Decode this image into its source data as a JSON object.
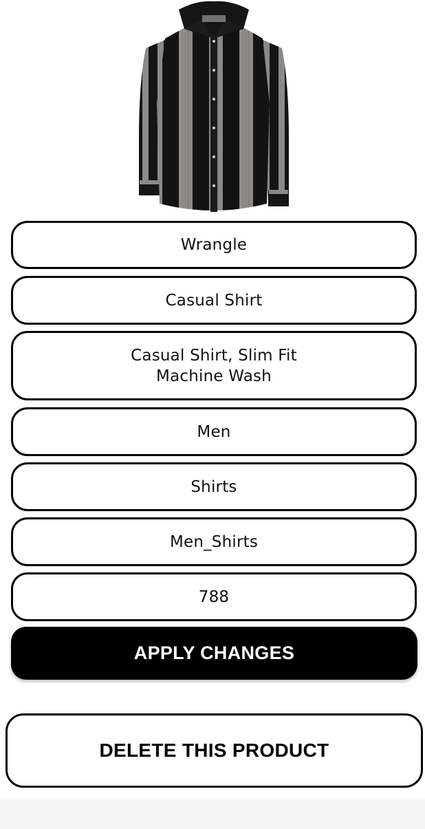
{
  "product": {
    "image_name": "striped-shirt-image",
    "fields": {
      "brand": "Wrangle",
      "title": "Casual Shirt",
      "description_line1": "Casual Shirt, Slim Fit",
      "description_line2": "Machine Wash",
      "gender": "Men",
      "category": "Shirts",
      "subcategory": "Men_Shirts",
      "price": "788"
    }
  },
  "actions": {
    "apply_label": "APPLY CHANGES",
    "delete_label": "DELETE THIS PRODUCT"
  },
  "colors": {
    "primary": "#000000",
    "background": "#ffffff",
    "shirt_dark": "#141414",
    "shirt_grey": "#8a8886"
  }
}
